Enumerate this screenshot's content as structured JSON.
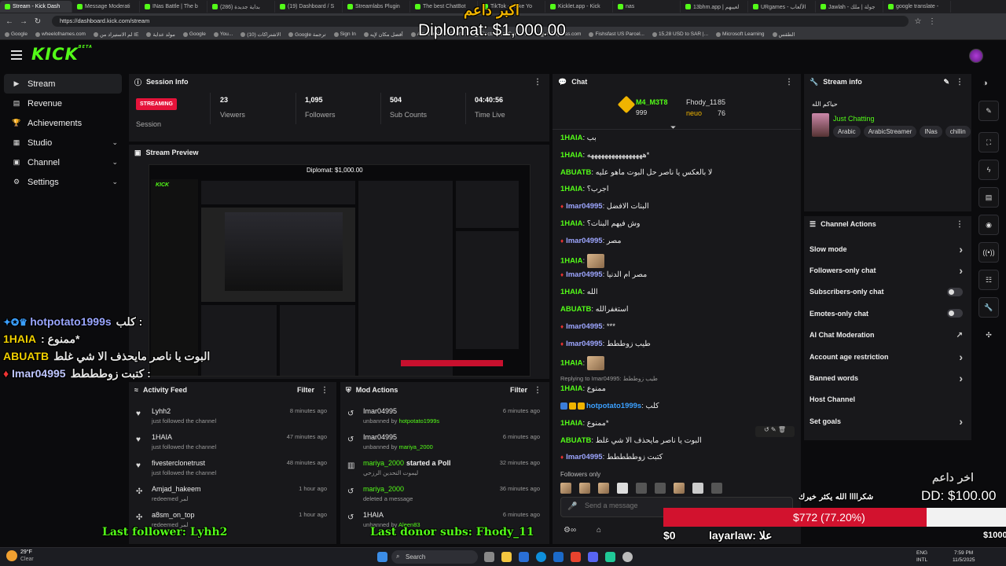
{
  "browser": {
    "tabs": [
      "Stream - Kick Dash",
      "Message Moderati",
      "INas Battle | The b",
      "(286) بداية جديدة",
      "(19) Dashboard / S",
      "Streamlabs Plugin",
      "The best ChatBot",
      "TikTok - Make Yo",
      "Kicklet.app - Kick",
      "nas",
      "13bhm.app | لعيبهم",
      "URgames - الألعاب",
      "Jawlah - جولة | ملك",
      "google translate -"
    ],
    "url": "https://dashboard.kick.com/stream",
    "bookmarks": [
      "Google",
      "wheelofnames.com",
      "لم الاستيراد من IE",
      "مولد عداية",
      "Google",
      "You...",
      "(10) الاشتراكات",
      "Google ترجمة",
      "Sign In",
      "أفضل مكان لإيه",
      "Amazon.com: Onlin...",
      "Electronics, Cars, Fa...",
      "AliExpress.com",
      "Fishsfast US Parcel...",
      "15,28 USD to SAR |...",
      "Microsoft Learning",
      "الطقس"
    ]
  },
  "brand": {
    "logo": "KICK",
    "logo_sup": "BETA"
  },
  "sidebar": {
    "items": [
      {
        "label": "Stream",
        "icon": "video-icon"
      },
      {
        "label": "Revenue",
        "icon": "revenue-icon"
      },
      {
        "label": "Achievements",
        "icon": "trophy-icon"
      },
      {
        "label": "Studio",
        "icon": "studio-icon"
      },
      {
        "label": "Channel",
        "icon": "channel-icon"
      },
      {
        "label": "Settings",
        "icon": "gear-icon"
      }
    ]
  },
  "session": {
    "title": "Session Info",
    "badge": "STREAMING",
    "badge_label": "Session",
    "stats": [
      {
        "value": "23",
        "label": "Viewers"
      },
      {
        "value": "1,095",
        "label": "Followers"
      },
      {
        "value": "504",
        "label": "Sub Counts"
      },
      {
        "value": "04:40:56",
        "label": "Time Live"
      }
    ]
  },
  "preview": {
    "title": "Stream Preview"
  },
  "activity": {
    "title": "Activity Feed",
    "filter": "Filter",
    "rows": [
      {
        "name": "Lyhh2",
        "desc": "just followed the channel",
        "time": "8 minutes ago",
        "icon": "heart-icon"
      },
      {
        "name": "1HAIA",
        "desc": "just followed the channel",
        "time": "47 minutes ago",
        "icon": "heart-icon"
      },
      {
        "name": "fivesterclonetrust",
        "desc": "just followed the channel",
        "time": "48 minutes ago",
        "icon": "heart-icon"
      },
      {
        "name": "Amjad_hakeem",
        "desc": "redeemed لمر",
        "time": "1 hour ago",
        "icon": "redeem-icon"
      },
      {
        "name": "a8sm_on_top",
        "desc": "redeemed لمر",
        "time": "1 hour ago",
        "icon": "redeem-icon"
      }
    ]
  },
  "mod": {
    "title": "Mod Actions",
    "filter": "Filter",
    "rows": [
      {
        "name": "Imar04995",
        "desc_pre": "unbanned by ",
        "desc_user": "hotpotato1999s",
        "time": "6 minutes ago"
      },
      {
        "name": "Imar04995",
        "desc_pre": "unbanned by ",
        "desc_user": "mariya_2000",
        "time": "6 minutes ago"
      },
      {
        "name": "mariya_2000",
        "desc_pre": "ليموت التحدين الرزحي",
        "desc_user": "",
        "time": "32 minutes ago",
        "extra": "started a Poll"
      },
      {
        "name": "mariya_2000",
        "desc_pre": "deleted a message",
        "desc_user": "",
        "time": "36 minutes ago"
      },
      {
        "name": "1HAIA",
        "desc_pre": "unbanned by ",
        "desc_user": "Aleen83",
        "time": "6 minutes ago"
      }
    ]
  },
  "chat": {
    "title": "Chat",
    "top1_name": "M4_M3T8",
    "top1_val": "999",
    "top2_name": "Fhody_11",
    "top2_val": "85",
    "top3_name": "neuo",
    "top3_val": "76",
    "lines": [
      {
        "user": "1HAIA",
        "cls": "u1",
        "msg": "بب"
      },
      {
        "user": "1HAIA",
        "cls": "u1",
        "msg": "ههههههههههههههههه*"
      },
      {
        "user": "ABUATB",
        "cls": "u1",
        "msg": "لا بالعكس يا ناصر حل البوت ماهو عليه"
      },
      {
        "user": "1HAIA",
        "cls": "u1",
        "msg": "اجرب؟"
      },
      {
        "user": "Imar04995",
        "cls": "u2",
        "msg": "البنات الافضل",
        "shield": true
      },
      {
        "user": "1HAIA",
        "cls": "u1",
        "msg": "وش فيهم البنات؟"
      },
      {
        "user": "Imar04995",
        "cls": "u2",
        "msg": "مصر",
        "shield": true
      },
      {
        "user": "1HAIA",
        "cls": "u1",
        "msg": "",
        "emote": true
      },
      {
        "user": "Imar04995",
        "cls": "u2",
        "msg": "مصر ام الدنيا",
        "shield": true
      },
      {
        "user": "1HAIA",
        "cls": "u1",
        "msg": "الله"
      },
      {
        "user": "ABUATB",
        "cls": "u1",
        "msg": "استغفرالله"
      },
      {
        "user": "Imar04995",
        "cls": "u2",
        "msg": "***",
        "shield": true
      },
      {
        "user": "Imar04995",
        "cls": "u2",
        "msg": "طيب زوططط",
        "shield": true
      },
      {
        "user": "1HAIA",
        "cls": "u1",
        "msg": "",
        "emote": true
      }
    ],
    "reply_note": "Replying to Imar04995: طيب زوططط",
    "lines2": [
      {
        "user": "1HAIA",
        "cls": "u1",
        "msg": "ممنوع"
      },
      {
        "user": "hotpotato1999s",
        "cls": "u3",
        "msg": "كلب",
        "badges": true
      },
      {
        "user": "1HAIA",
        "cls": "u1",
        "msg": "ممنوع*"
      },
      {
        "user": "ABUATB",
        "cls": "u1",
        "msg": "البوت يا ناصر مايحذف الا شي غلط"
      },
      {
        "user": "Imar04995",
        "cls": "u2",
        "msg": "كتبت زوططططط",
        "shield": true
      }
    ],
    "followers_only": "Followers only",
    "placeholder": "Send a message"
  },
  "streaminfo": {
    "title": "Stream info",
    "stream_title": "حياكم الله",
    "category": "Just Chatting",
    "tags": [
      "Arabic",
      "ArabicStreamer",
      "INas",
      "chillin"
    ]
  },
  "actions": {
    "title": "Channel Actions",
    "items": [
      {
        "label": "Slow mode",
        "type": "chevron"
      },
      {
        "label": "Followers-only chat",
        "type": "chevron"
      },
      {
        "label": "Subscribers-only chat",
        "type": "toggle"
      },
      {
        "label": "Emotes-only chat",
        "type": "toggle"
      },
      {
        "label": "AI Chat Moderation",
        "type": "external"
      },
      {
        "label": "Account age restriction",
        "type": "chevron"
      },
      {
        "label": "Banned words",
        "type": "chevron"
      },
      {
        "label": "Host Channel",
        "type": "none"
      },
      {
        "label": "Set goals",
        "type": "chevron"
      }
    ]
  },
  "overlay": {
    "top_label": "اكبر داعم",
    "top_amount": "Diplomat: $1,000.00",
    "last_label": "اخر داعم",
    "last_amount": "DD: $100.00",
    "thanks": "شكراااا الله يكثر خيرك",
    "goal_text": "$772 (77.20%)",
    "goal_fraction": 0.772,
    "goal_zero": "$0",
    "goal_name": "layarlaw: علا",
    "goal_max": "$1000",
    "last_follower": "Last follower: Lyhh2",
    "last_donor": "Last donor subs: Fhody_11",
    "chat_overlay": [
      {
        "user": "hotpotato1999s",
        "msg": "كلب :"
      },
      {
        "user": "1HAIA",
        "msg": ": ممنوع*"
      },
      {
        "user": "ABUATB",
        "msg": "البوت يا ناصر مايحذف الا شي غلط"
      },
      {
        "user": "Imar04995",
        "msg": "كتبت زوطططط :"
      }
    ]
  },
  "taskbar": {
    "search": "Search",
    "weather_temp": "29°F",
    "weather_desc": "Clear",
    "lang": "ENG",
    "lang2": "INTL",
    "time": "7:59 PM",
    "date": "11/5/2025"
  }
}
